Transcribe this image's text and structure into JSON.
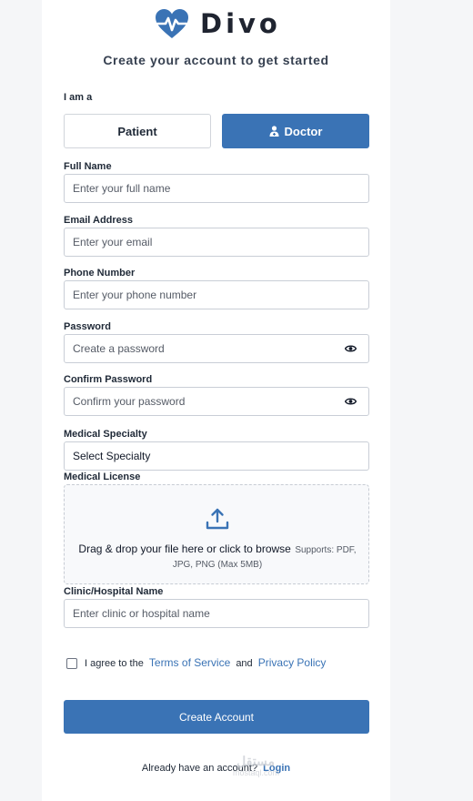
{
  "brand": {
    "name": "Divo",
    "subtitle": "Create your account to get started",
    "logo_icon": "heart-pulse-icon",
    "accent_color": "#3a73b5"
  },
  "role": {
    "label": "I am a",
    "options": [
      "Patient",
      "Doctor"
    ],
    "selected": "Doctor",
    "doctor_icon": "doctor-icon"
  },
  "fields": {
    "full_name": {
      "label": "Full Name",
      "placeholder": "Enter your full name"
    },
    "email": {
      "label": "Email Address",
      "placeholder": "Enter your email"
    },
    "phone": {
      "label": "Phone Number",
      "placeholder": "Enter your phone number"
    },
    "password": {
      "label": "Password",
      "placeholder": "Create a password",
      "toggle_icon": "eye-icon"
    },
    "confirm_password": {
      "label": "Confirm Password",
      "placeholder": "Confirm your password",
      "toggle_icon": "eye-icon"
    },
    "specialty": {
      "label": "Medical Specialty",
      "value": "Select Specialty"
    },
    "license": {
      "label": "Medical License",
      "upload_icon": "upload-icon",
      "dropzone_text": "Drag & drop your file here or click to browse",
      "dropzone_hint": "Supports: PDF, JPG, PNG (Max 5MB)"
    },
    "clinic": {
      "label": "Clinic/Hospital Name",
      "placeholder": "Enter clinic or hospital name"
    }
  },
  "agreement": {
    "checked": false,
    "prefix": "I agree to the",
    "terms_link": "Terms of Service",
    "conjunction": "and",
    "privacy_link": "Privacy Policy"
  },
  "submit_label": "Create Account",
  "footer": {
    "prompt": "Already have an account?",
    "login_link": "Login"
  },
  "watermark": {
    "line1": "مستقل",
    "line2": "mostaql.com"
  }
}
